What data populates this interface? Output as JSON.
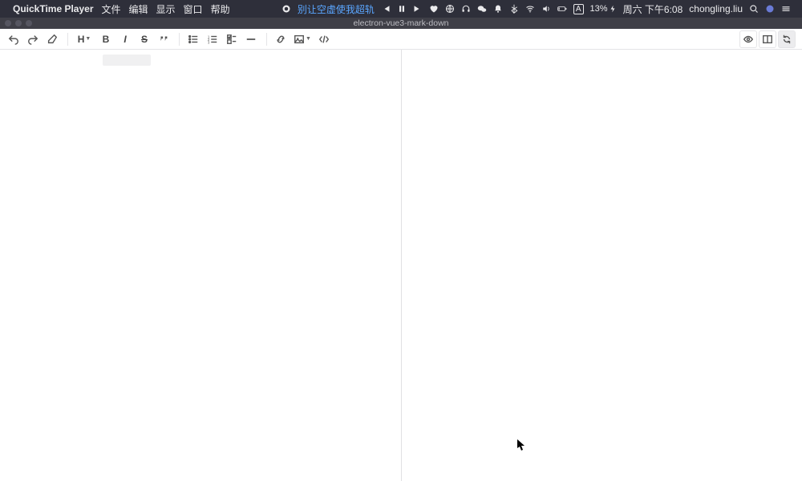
{
  "menubar": {
    "apple": "",
    "app_name": "QuickTime Player",
    "menus": [
      "文件",
      "编辑",
      "显示",
      "窗口",
      "帮助"
    ],
    "now_playing": "别让空虚使我超轨",
    "battery_pct": "13%",
    "ime_label": "A",
    "clock": "周六 下午6:08",
    "username": "chongling.liu"
  },
  "window": {
    "title": "electron-vue3-mark-down"
  },
  "toolbar": {
    "undo": "↶",
    "redo": "↷",
    "clear": "⌫",
    "heading": "H",
    "bold": "B",
    "italic": "I",
    "strike": "S",
    "quote": "❝",
    "ul": "•",
    "ol": "1.",
    "task": "☑",
    "hr": "—",
    "link": "🔗",
    "image": "🖼",
    "code": "</>",
    "preview": "👁",
    "split": "◫",
    "sync": "⟳"
  }
}
